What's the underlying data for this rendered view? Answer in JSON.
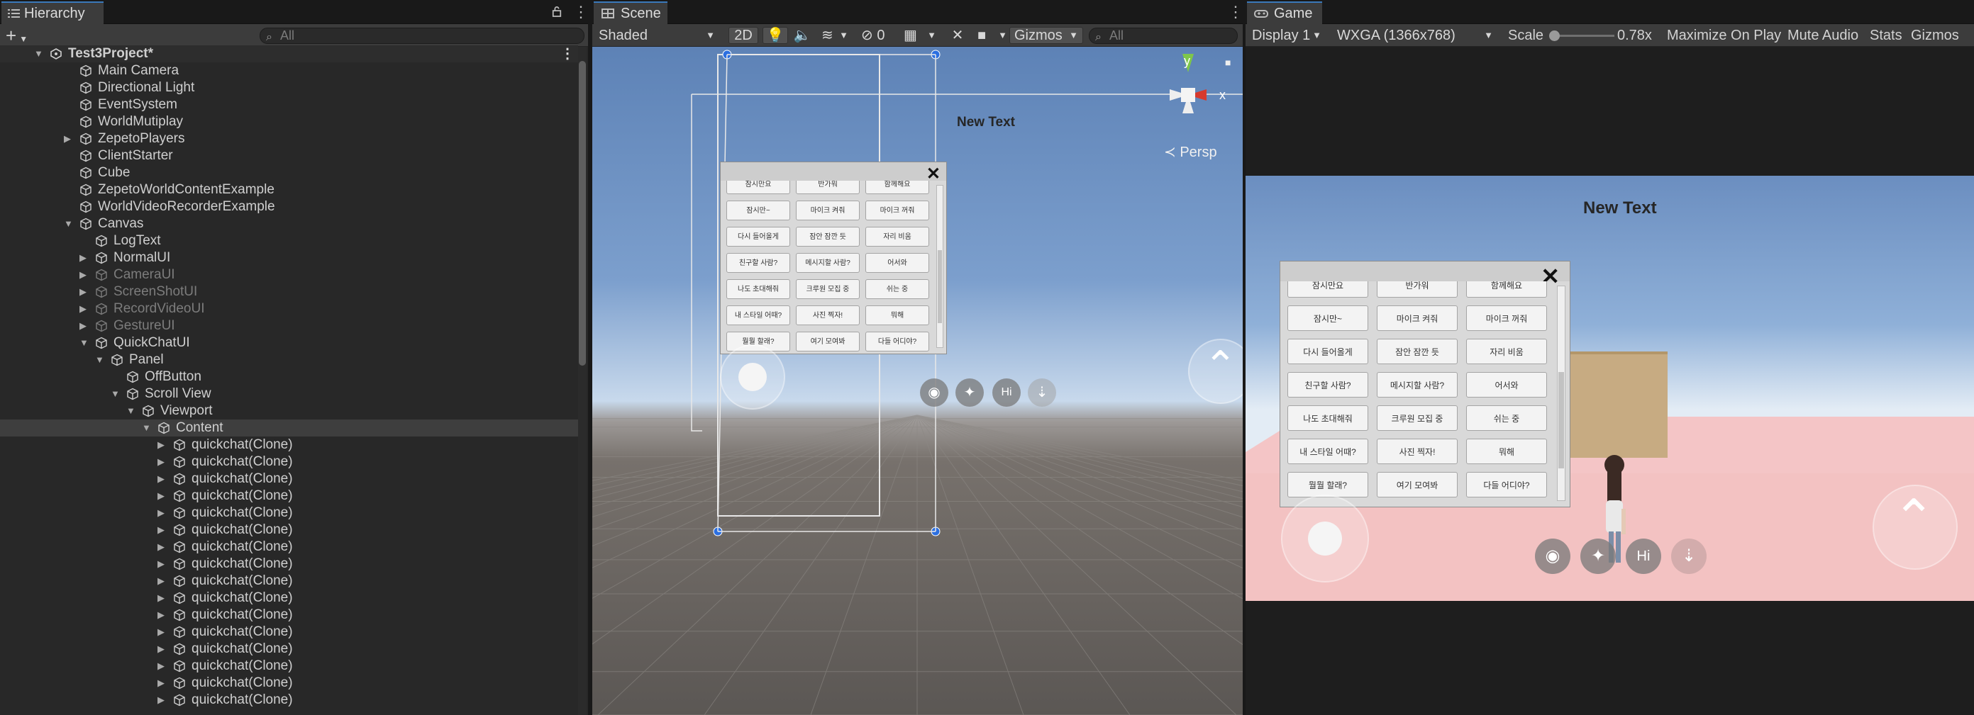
{
  "hierarchy": {
    "tab_label": "Hierarchy",
    "add_label": "+",
    "search_placeholder": "All",
    "rows": [
      {
        "label": "Test3Project*",
        "depth": 0,
        "arrow": "down",
        "kind": "scene",
        "state": "root"
      },
      {
        "label": "Main Camera",
        "depth": 1,
        "arrow": "",
        "kind": "go",
        "state": ""
      },
      {
        "label": "Directional Light",
        "depth": 1,
        "arrow": "",
        "kind": "go",
        "state": ""
      },
      {
        "label": "EventSystem",
        "depth": 1,
        "arrow": "",
        "kind": "go",
        "state": ""
      },
      {
        "label": "WorldMutiplay",
        "depth": 1,
        "arrow": "",
        "kind": "go",
        "state": ""
      },
      {
        "label": "ZepetoPlayers",
        "depth": 1,
        "arrow": "right",
        "kind": "go",
        "state": ""
      },
      {
        "label": "ClientStarter",
        "depth": 1,
        "arrow": "",
        "kind": "go",
        "state": ""
      },
      {
        "label": "Cube",
        "depth": 1,
        "arrow": "",
        "kind": "go",
        "state": ""
      },
      {
        "label": "ZepetoWorldContentExample",
        "depth": 1,
        "arrow": "",
        "kind": "go",
        "state": ""
      },
      {
        "label": "WorldVideoRecorderExample",
        "depth": 1,
        "arrow": "",
        "kind": "go",
        "state": ""
      },
      {
        "label": "Canvas",
        "depth": 1,
        "arrow": "down",
        "kind": "go",
        "state": ""
      },
      {
        "label": "LogText",
        "depth": 2,
        "arrow": "",
        "kind": "go",
        "state": ""
      },
      {
        "label": "NormalUI",
        "depth": 2,
        "arrow": "right",
        "kind": "go",
        "state": ""
      },
      {
        "label": "CameraUI",
        "depth": 2,
        "arrow": "right",
        "kind": "go",
        "state": "dim"
      },
      {
        "label": "ScreenShotUI",
        "depth": 2,
        "arrow": "right",
        "kind": "go",
        "state": "dim"
      },
      {
        "label": "RecordVideoUI",
        "depth": 2,
        "arrow": "right",
        "kind": "go",
        "state": "dim"
      },
      {
        "label": "GestureUI",
        "depth": 2,
        "arrow": "right",
        "kind": "go",
        "state": "dim"
      },
      {
        "label": "QuickChatUI",
        "depth": 2,
        "arrow": "down",
        "kind": "go",
        "state": ""
      },
      {
        "label": "Panel",
        "depth": 3,
        "arrow": "down",
        "kind": "go",
        "state": ""
      },
      {
        "label": "OffButton",
        "depth": 4,
        "arrow": "",
        "kind": "go",
        "state": ""
      },
      {
        "label": "Scroll View",
        "depth": 4,
        "arrow": "down",
        "kind": "go",
        "state": ""
      },
      {
        "label": "Viewport",
        "depth": 5,
        "arrow": "down",
        "kind": "go",
        "state": ""
      },
      {
        "label": "Content",
        "depth": 6,
        "arrow": "down",
        "kind": "go",
        "state": "sel"
      },
      {
        "label": "quickchat(Clone)",
        "depth": 7,
        "arrow": "right",
        "kind": "go",
        "state": ""
      },
      {
        "label": "quickchat(Clone)",
        "depth": 7,
        "arrow": "right",
        "kind": "go",
        "state": ""
      },
      {
        "label": "quickchat(Clone)",
        "depth": 7,
        "arrow": "right",
        "kind": "go",
        "state": ""
      },
      {
        "label": "quickchat(Clone)",
        "depth": 7,
        "arrow": "right",
        "kind": "go",
        "state": ""
      },
      {
        "label": "quickchat(Clone)",
        "depth": 7,
        "arrow": "right",
        "kind": "go",
        "state": ""
      },
      {
        "label": "quickchat(Clone)",
        "depth": 7,
        "arrow": "right",
        "kind": "go",
        "state": ""
      },
      {
        "label": "quickchat(Clone)",
        "depth": 7,
        "arrow": "right",
        "kind": "go",
        "state": ""
      },
      {
        "label": "quickchat(Clone)",
        "depth": 7,
        "arrow": "right",
        "kind": "go",
        "state": ""
      },
      {
        "label": "quickchat(Clone)",
        "depth": 7,
        "arrow": "right",
        "kind": "go",
        "state": ""
      },
      {
        "label": "quickchat(Clone)",
        "depth": 7,
        "arrow": "right",
        "kind": "go",
        "state": ""
      },
      {
        "label": "quickchat(Clone)",
        "depth": 7,
        "arrow": "right",
        "kind": "go",
        "state": ""
      },
      {
        "label": "quickchat(Clone)",
        "depth": 7,
        "arrow": "right",
        "kind": "go",
        "state": ""
      },
      {
        "label": "quickchat(Clone)",
        "depth": 7,
        "arrow": "right",
        "kind": "go",
        "state": ""
      },
      {
        "label": "quickchat(Clone)",
        "depth": 7,
        "arrow": "right",
        "kind": "go",
        "state": ""
      },
      {
        "label": "quickchat(Clone)",
        "depth": 7,
        "arrow": "right",
        "kind": "go",
        "state": ""
      },
      {
        "label": "quickchat(Clone)",
        "depth": 7,
        "arrow": "right",
        "kind": "go",
        "state": ""
      }
    ]
  },
  "scene": {
    "tab_label": "Scene",
    "shading_mode": "Shaded",
    "mode_2d_label": "2D",
    "hidden_count": "0",
    "gizmos_label": "Gizmos",
    "search_placeholder": "All",
    "persp_label": "≺ Persp",
    "axis_y": "y",
    "axis_x": "x",
    "new_text": "New Text"
  },
  "game": {
    "tab_label": "Game",
    "display": "Display 1",
    "resolution": "WXGA (1366x768)",
    "scale_label": "Scale",
    "scale_value": "0.78x",
    "maximize_label": "Maximize On Play",
    "mute_label": "Mute Audio",
    "stats_label": "Stats",
    "gizmos_label": "Gizmos",
    "new_text": "New Text"
  },
  "quickchat": {
    "close_glyph": "✕",
    "top_partial": [
      "잠시만요",
      "반가워",
      "함께해요"
    ],
    "buttons": [
      "잠시만~",
      "마이크 켜줘",
      "마이크 꺼줘",
      "다시 들어올게",
      "잠안 잠깐 듯",
      "자리 비움",
      "친구할 사람?",
      "메시지할 사람?",
      "어서와",
      "나도 초대해줘",
      "크루원 모집 중",
      "쉬는 중",
      "내 스타일 어때?",
      "사진 찍자!",
      "뭐해",
      "뭘뭘 할래?",
      "여기 모여봐",
      "다들 어디야?"
    ]
  },
  "icons": {
    "hierarchy": "hierarchy-list-icon",
    "scene": "scene-grid-icon",
    "game": "game-controller-icon",
    "lock": "lock-icon",
    "kebab": "more-options-icon",
    "gameobject": "cube-icon"
  },
  "colors": {
    "accent": "#3a79bb",
    "selection_row": "#3e3e3e",
    "sky_top": "#5f84b8",
    "game_floor": "#f3c4c4"
  }
}
